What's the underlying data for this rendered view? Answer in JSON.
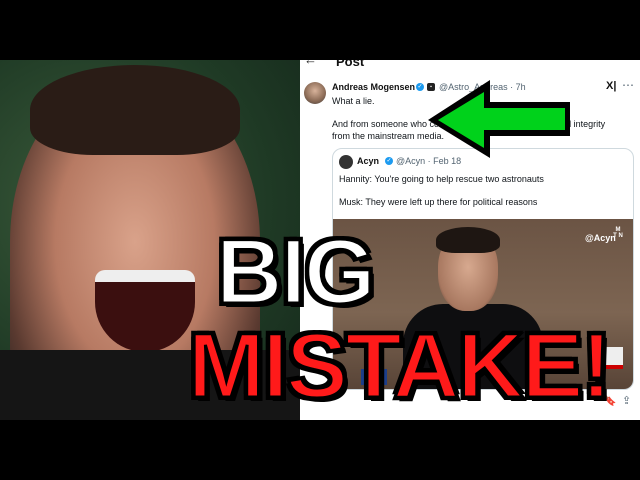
{
  "thumbnail": {
    "headline_line1": "BIG",
    "headline_line2": "MISTAKE!",
    "headline_color_1": "#ffffff",
    "headline_color_2": "#ff1a1a",
    "arrow_color": "#00d21b"
  },
  "post": {
    "header_title": "Post",
    "author_name": "Andreas Mogensen",
    "author_handle": "@Astro_Andreas · 7h",
    "text_line1": "What a lie.",
    "text_line2": "And from someone who complains about disinformation and integrity from the mainstream media.",
    "x_mark": "X|",
    "quoted": {
      "author_name": "Acyn",
      "author_handle": "@Acyn · Feb 18",
      "text_line1": "Hannity: You're going to help rescue two astronauts",
      "text_line2": "Musk: They were left up there for political reasons",
      "media_watermark": "@Acyn",
      "media_logo": "M T N",
      "media_badge": "FOX NEWS"
    }
  },
  "icons": {
    "back": "back-arrow-icon",
    "verified": "verified-badge-icon",
    "more": "more-icon",
    "bookmark": "bookmark-icon",
    "share": "share-icon"
  }
}
